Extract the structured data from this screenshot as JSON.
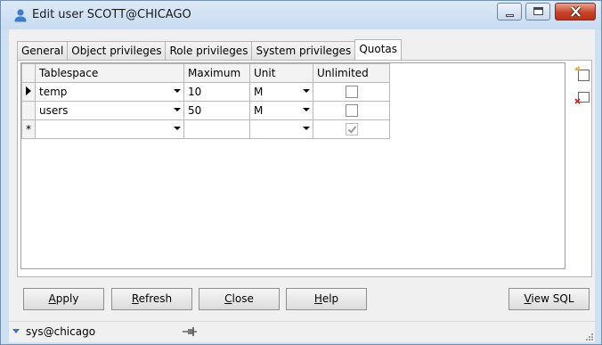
{
  "window": {
    "title": "Edit user SCOTT@CHICAGO",
    "accent": "#cfe0f3",
    "close_color": "#c7442a"
  },
  "tabs": [
    {
      "label": "General",
      "active": false
    },
    {
      "label": "Object privileges",
      "active": false
    },
    {
      "label": "Role privileges",
      "active": false
    },
    {
      "label": "System privileges",
      "active": false
    },
    {
      "label": "Quotas",
      "active": true
    }
  ],
  "grid": {
    "columns": [
      "Tablespace",
      "Maximum",
      "Unit",
      "Unlimited"
    ],
    "rows": [
      {
        "tablespace": "temp",
        "maximum": "10",
        "unit": "M",
        "unlimited": false,
        "current": true
      },
      {
        "tablespace": "users",
        "maximum": "50",
        "unit": "M",
        "unlimited": false,
        "current": false
      }
    ],
    "new_row_marker": "*"
  },
  "side_toolbar": [
    {
      "icon": "add-row-icon"
    },
    {
      "icon": "delete-row-icon"
    }
  ],
  "buttons": {
    "apply": {
      "prefix": "",
      "accel": "A",
      "rest": "pply"
    },
    "refresh": {
      "prefix": "",
      "accel": "R",
      "rest": "efresh"
    },
    "close": {
      "prefix": "",
      "accel": "C",
      "rest": "lose"
    },
    "help": {
      "prefix": "",
      "accel": "H",
      "rest": "elp"
    },
    "view_sql": {
      "prefix": "",
      "accel": "V",
      "rest": "iew SQL"
    }
  },
  "statusbar": {
    "connection": "sys@chicago"
  }
}
